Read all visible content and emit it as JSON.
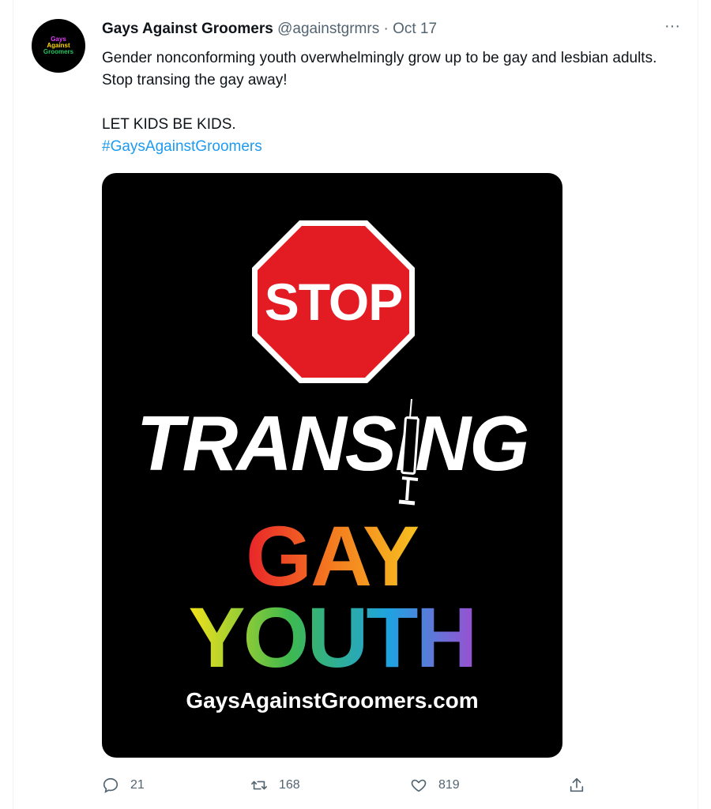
{
  "tweet": {
    "author_name": "Gays Against Groomers",
    "handle": "@againstgrmrs",
    "separator": "·",
    "date": "Oct 17",
    "more_label": "···",
    "avatar_lines": [
      "Gays",
      "Against",
      "Groomers"
    ],
    "text_line1": "Gender nonconforming youth overwhelmingly grow up to be gay and lesbian adults. Stop transing the gay away!",
    "text_line2": "LET KIDS BE KIDS.",
    "hashtag": "#GaysAgainstGroomers"
  },
  "media": {
    "stop_sign_text": "STOP",
    "headline": "TRANSING",
    "word_gay": "GAY",
    "word_youth": "YOUTH",
    "website": "GaysAgainstGroomers.com",
    "colors": {
      "stop_red": "#e31b23",
      "gay_gradient": [
        "#e8232a",
        "#f47b20",
        "#f7c120"
      ],
      "youth_gradient": [
        "#f5e21a",
        "#3fb94e",
        "#1fa2e0",
        "#9b4fd1"
      ]
    }
  },
  "actions": {
    "reply_count": "21",
    "retweet_count": "168",
    "like_count": "819",
    "icons": [
      "reply-icon",
      "retweet-icon",
      "like-icon",
      "share-icon"
    ]
  }
}
